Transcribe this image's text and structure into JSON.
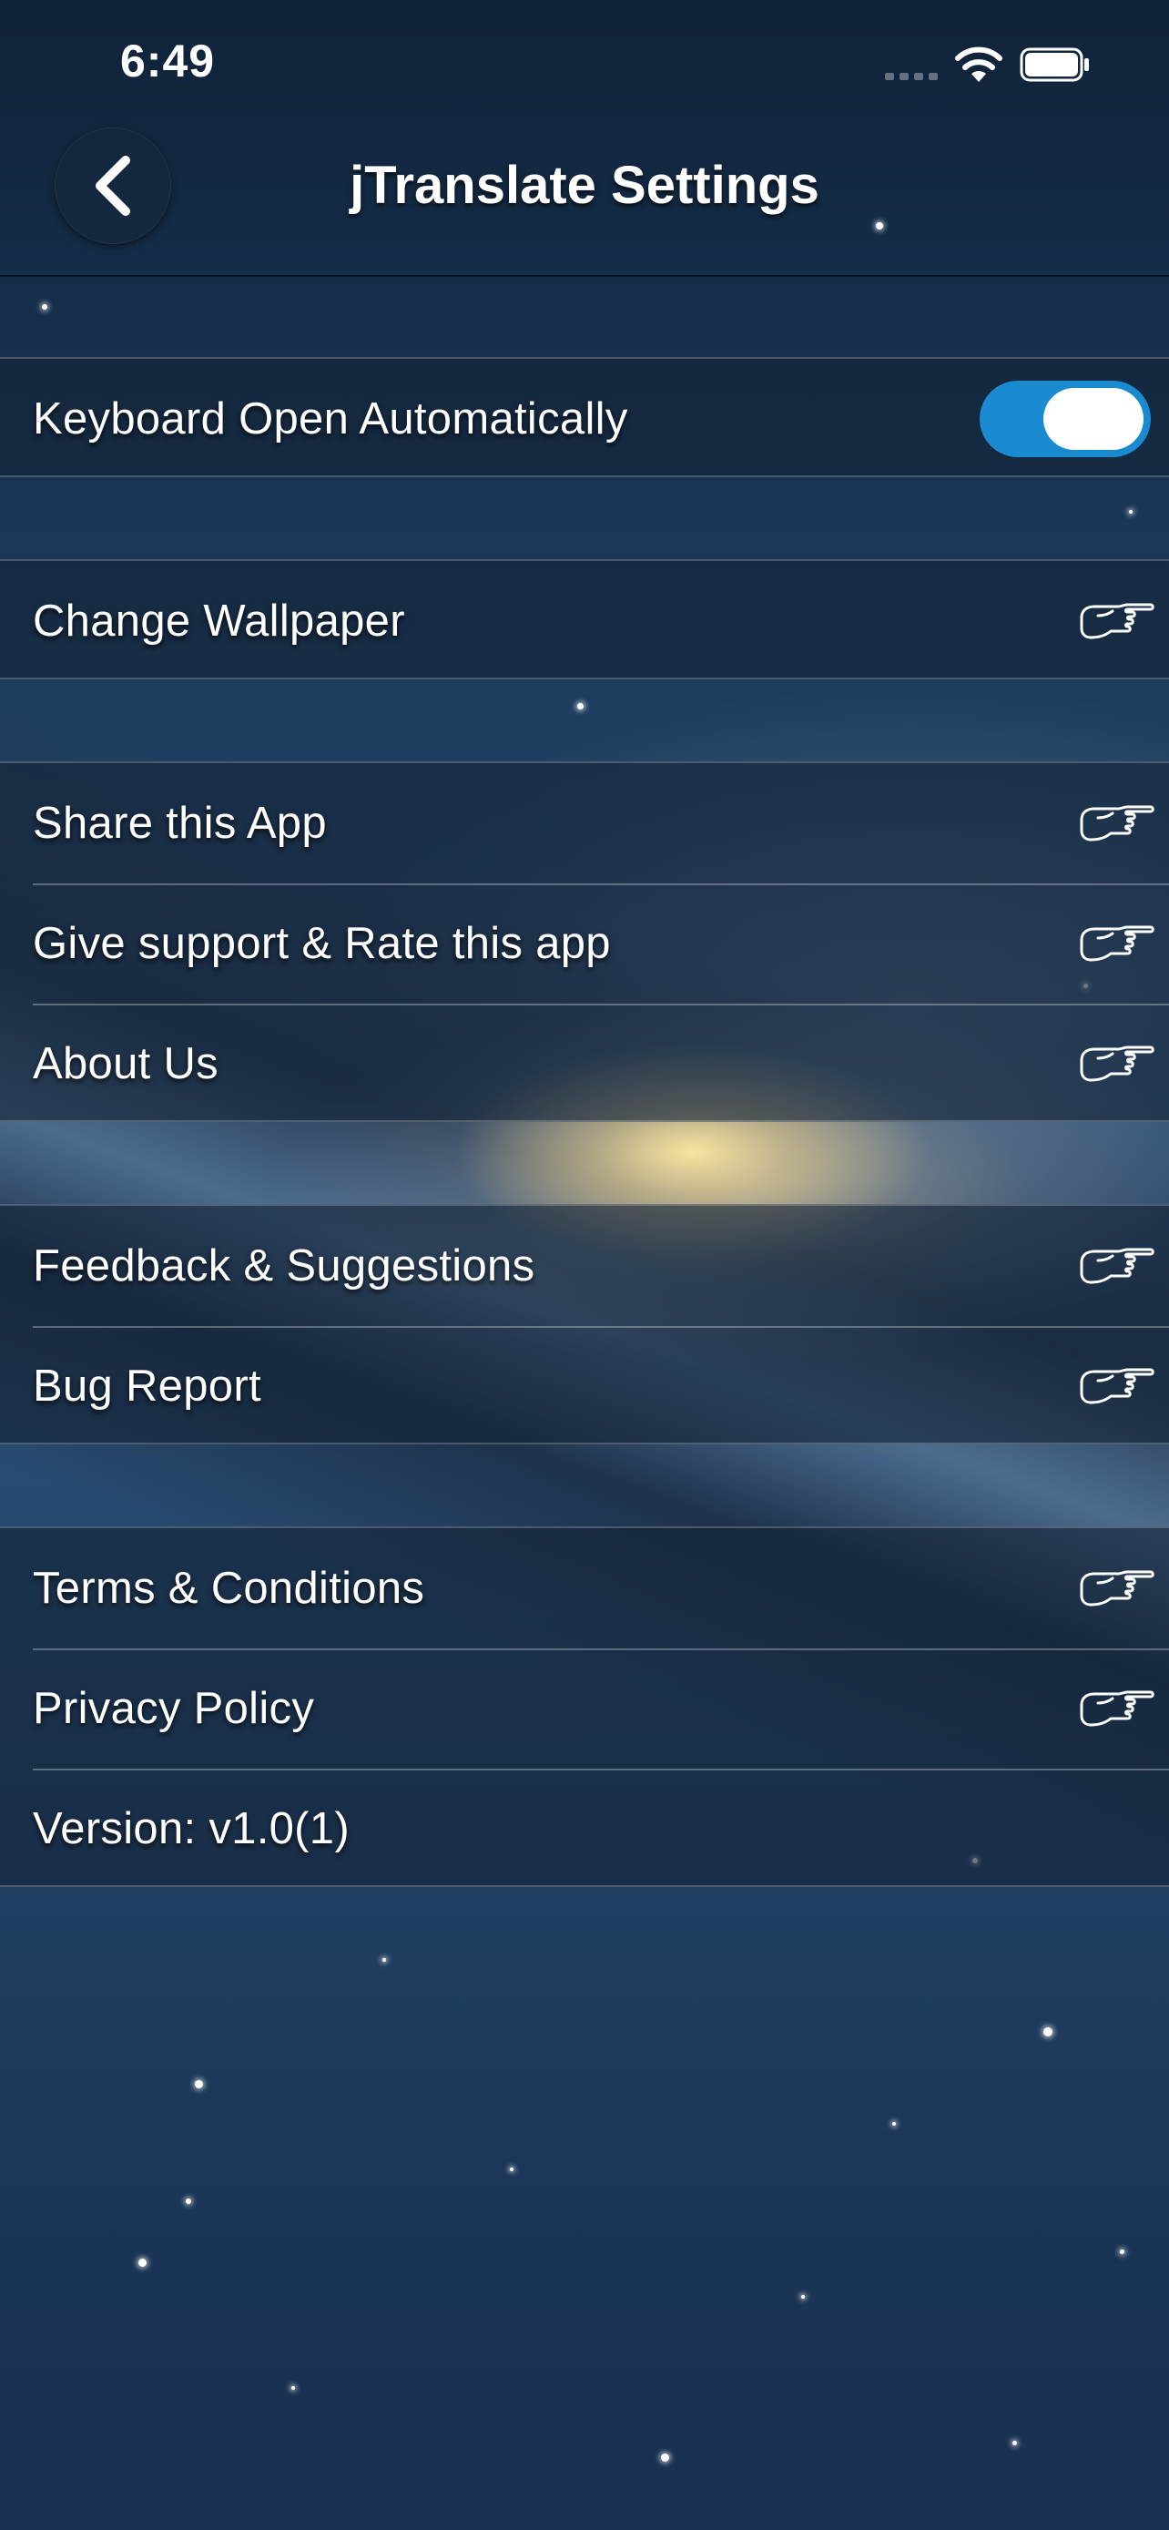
{
  "status_bar": {
    "time": "6:49"
  },
  "nav": {
    "title": "jTranslate Settings",
    "back_icon": "chevron-left-icon"
  },
  "groups": {
    "keyboard": {
      "label": "Keyboard Open Automatically",
      "toggle_on": true,
      "toggle_color": "#1a8bd0"
    },
    "wallpaper": {
      "items": [
        {
          "label": "Change Wallpaper",
          "icon": "pointing-hand-icon"
        }
      ]
    },
    "app": {
      "items": [
        {
          "label": "Share this App",
          "icon": "pointing-hand-icon"
        },
        {
          "label": "Give support & Rate this app",
          "icon": "pointing-hand-icon"
        },
        {
          "label": "About Us",
          "icon": "pointing-hand-icon"
        }
      ]
    },
    "feedback": {
      "items": [
        {
          "label": "Feedback & Suggestions",
          "icon": "pointing-hand-icon"
        },
        {
          "label": "Bug Report",
          "icon": "pointing-hand-icon"
        }
      ]
    },
    "legal": {
      "items": [
        {
          "label": "Terms & Conditions",
          "icon": "pointing-hand-icon"
        },
        {
          "label": "Privacy Policy",
          "icon": "pointing-hand-icon"
        }
      ],
      "version": "Version: v1.0(1)"
    }
  }
}
